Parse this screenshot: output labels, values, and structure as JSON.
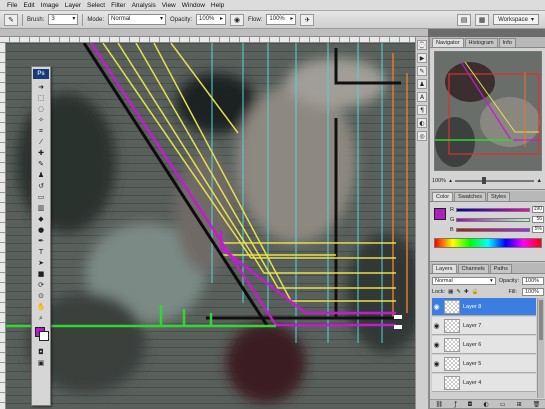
{
  "menu": [
    "File",
    "Edit",
    "Image",
    "Layer",
    "Select",
    "Filter",
    "Analysis",
    "View",
    "Window",
    "Help"
  ],
  "options": {
    "brush_label": "Brush:",
    "brush_size": "3",
    "mode_label": "Mode:",
    "mode_value": "Normal",
    "opacity_label": "Opacity:",
    "opacity_value": "100%",
    "flow_label": "Flow:",
    "flow_value": "100%",
    "workspace": "Workspace"
  },
  "tools_panel": {
    "logo": "Ps",
    "icons": [
      "move-icon",
      "marquee-icon",
      "lasso-icon",
      "quick-select-icon",
      "crop-icon",
      "eyedropper-icon",
      "healing-icon",
      "brush-icon",
      "stamp-icon",
      "history-brush-icon",
      "eraser-icon",
      "gradient-icon",
      "blur-icon",
      "dodge-icon",
      "pen-icon",
      "type-icon",
      "path-select-icon",
      "shape-icon",
      "3d-rotate-icon",
      "3d-orbit-icon",
      "hand-icon",
      "zoom-icon"
    ],
    "foreground_color": "#b020c0",
    "background_color": "#ffffff"
  },
  "navigator_panel": {
    "tabs": [
      "Navigator",
      "Histogram",
      "Info"
    ],
    "zoom": "100%"
  },
  "color_panel": {
    "tabs": [
      "Color",
      "Swatches",
      "Styles"
    ],
    "swatch": "#b020c0",
    "channels": [
      {
        "label": "R",
        "value": "190",
        "gradient": "linear-gradient(90deg,#0000c0,#ff00c0)"
      },
      {
        "label": "G",
        "value": "56",
        "gradient": "linear-gradient(90deg,#b000c0,#b0ffc0)"
      },
      {
        "label": "B",
        "value": "5%",
        "gradient": "linear-gradient(90deg,#b02000,#b020ff)"
      }
    ]
  },
  "layers_panel": {
    "tabs": [
      "Layers",
      "Channels",
      "Paths"
    ],
    "blend_mode": "Normal",
    "opacity_label": "Opacity:",
    "opacity_value": "100%",
    "lock_label": "Lock:",
    "fill_label": "Fill:",
    "fill_value": "100%",
    "layers": [
      {
        "name": "Layer 8",
        "selected": true,
        "visible": true
      },
      {
        "name": "Layer 7",
        "selected": false,
        "visible": true
      },
      {
        "name": "Layer 6",
        "selected": false,
        "visible": true
      },
      {
        "name": "Layer 5",
        "selected": false,
        "visible": true
      },
      {
        "name": "Layer 4",
        "selected": false,
        "visible": false
      }
    ]
  },
  "colors": {
    "perspective_yellow": "#e8e04a",
    "perspective_magenta": "#c21bd0",
    "horizon_green": "#2fd82f",
    "vertical_cyan": "#4fd6d6",
    "vertical_orange": "#e8772a",
    "selection_blue": "#3b7de0"
  }
}
